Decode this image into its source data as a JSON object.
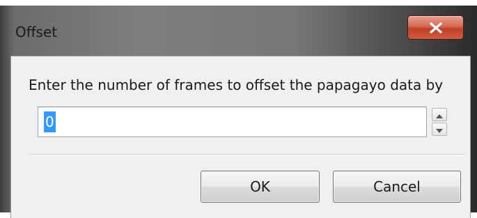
{
  "window": {
    "title": "Offset",
    "close_icon": "close-x-icon"
  },
  "dialog": {
    "prompt": "Enter the number of frames to offset the papagayo data by",
    "offset_input": {
      "value": "0"
    },
    "spin_up_icon": "arrow-up-icon",
    "spin_down_icon": "arrow-down-icon"
  },
  "buttons": {
    "ok_label": "OK",
    "cancel_label": "Cancel"
  },
  "colors": {
    "close_button": "#c7462e",
    "selection": "#3399ff",
    "client_background": "#f0f0f0"
  }
}
